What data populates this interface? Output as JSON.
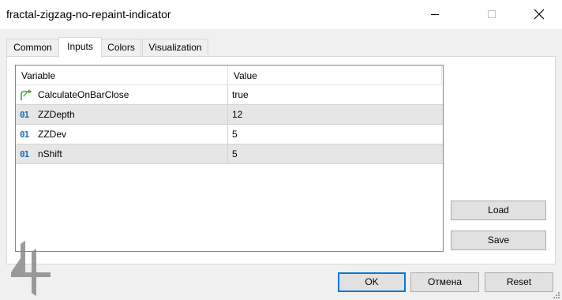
{
  "window": {
    "title": "fractal-zigzag-no-repaint-indicator"
  },
  "tabs": [
    {
      "label": "Common"
    },
    {
      "label": "Inputs"
    },
    {
      "label": "Colors"
    },
    {
      "label": "Visualization"
    }
  ],
  "active_tab": "Inputs",
  "table": {
    "headers": {
      "variable": "Variable",
      "value": "Value"
    },
    "rows": [
      {
        "icon": "bool-arrow-icon",
        "name": "CalculateOnBarClose",
        "value": "true"
      },
      {
        "icon": "int-type-icon",
        "icon_text": "01",
        "name": "ZZDepth",
        "value": "12"
      },
      {
        "icon": "int-type-icon",
        "icon_text": "01",
        "name": "ZZDev",
        "value": "5"
      },
      {
        "icon": "int-type-icon",
        "icon_text": "01",
        "name": "nShift",
        "value": "5"
      }
    ]
  },
  "side_buttons": {
    "load": "Load",
    "save": "Save"
  },
  "footer_buttons": {
    "ok": "OK",
    "cancel": "Отмена",
    "reset": "Reset"
  },
  "colors": {
    "accent": "#0078d7",
    "alt_row": "#e6e6e6",
    "icon_blue": "#1f6fb5",
    "icon_green": "#3aa23a"
  }
}
